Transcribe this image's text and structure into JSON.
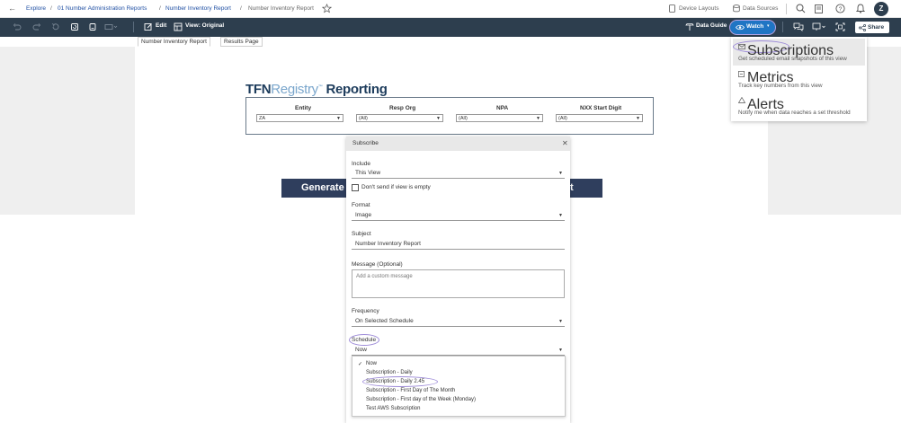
{
  "breadcrumb": {
    "back_label": "←",
    "explore": "Explore",
    "project": "01 Number Administration Reports",
    "workbook": "Number Inventory Report",
    "view": "Number Inventory Report",
    "separator": "/"
  },
  "topbar": {
    "device_layouts": "Device Layouts",
    "data_sources": "Data Sources",
    "avatar_initial": "Z"
  },
  "toolbar": {
    "edit": "Edit",
    "view_original": "View: Original",
    "data_guide": "Data Guide",
    "watch": "Watch",
    "share": "Share"
  },
  "tabs": [
    "Number Inventory Report",
    "Results Page"
  ],
  "dashboard": {
    "brand_a": "TFN",
    "brand_b": "Registry",
    "brand_tm": "™",
    "brand_c": " Reporting",
    "filters": [
      {
        "label": "Entity",
        "value": "ZA"
      },
      {
        "label": "Resp Org",
        "value": "(All)"
      },
      {
        "label": "NPA",
        "value": "(All)"
      },
      {
        "label": "NXX Start Digit",
        "value": "(All)"
      }
    ],
    "generate_left": "Generate R",
    "generate_right": "t"
  },
  "subscribe": {
    "title": "Subscribe",
    "close": "✕",
    "include_label": "Include",
    "include_value": "This View",
    "dont_send_label": "Don't send if view is empty",
    "format_label": "Format",
    "format_value": "Image",
    "subject_label": "Subject",
    "subject_value": "Number Inventory Report",
    "message_label": "Message (Optional)",
    "message_placeholder": "Add a custom message",
    "frequency_label": "Frequency",
    "frequency_value": "On Selected Schedule",
    "schedule_label": "Schedule",
    "schedule_value": "Now",
    "schedule_options": [
      "Now",
      "Subscription - Daily",
      "Subscription - Daily 2.45",
      "Subscription - First Day of The Month",
      "Subscription - First day of the Week (Monday)",
      "Test AWS Subscription"
    ],
    "selected_check": "✓"
  },
  "watch_menu": {
    "subscriptions_title": "Subscriptions",
    "subscriptions_desc": "Get scheduled email snapshots of this view",
    "metrics_title": "Metrics",
    "metrics_desc": "Track key numbers from this view",
    "alerts_title": "Alerts",
    "alerts_desc": "Notify me when data reaches a set threshold"
  },
  "colors": {
    "toolbar_bg": "#2d3e4e",
    "accent": "#1f75c4",
    "highlight_ring": "#9d8bd8",
    "generate_btn": "#2f3e5d"
  }
}
